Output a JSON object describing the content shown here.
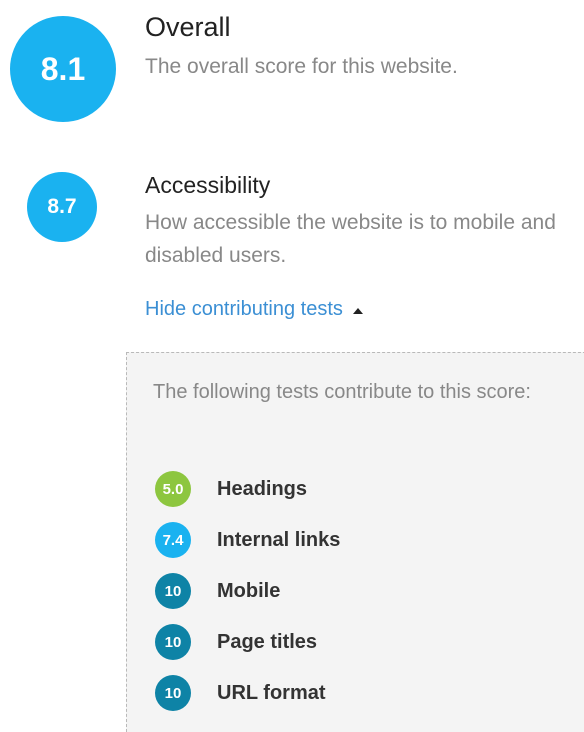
{
  "overall": {
    "score": "8.1",
    "title": "Overall",
    "description": "The overall score for this website."
  },
  "accessibility": {
    "score": "8.7",
    "title": "Accessibility",
    "description": "How accessible the website is to mobile and disabled users.",
    "toggle_label": "Hide contributing tests",
    "panel": {
      "intro": "The following tests contribute to this score:",
      "tests": [
        {
          "score": "5.0",
          "name": "Headings",
          "color": "#8dc63f"
        },
        {
          "score": "7.4",
          "name": "Internal links",
          "color": "#1ab2f0"
        },
        {
          "score": "10",
          "name": "Mobile",
          "color": "#0e83a6"
        },
        {
          "score": "10",
          "name": "Page titles",
          "color": "#0e83a6"
        },
        {
          "score": "10",
          "name": "URL format",
          "color": "#0e83a6"
        }
      ]
    }
  },
  "colors": {
    "score_blue": "#1ab2f0",
    "score_dark": "#0e83a6",
    "score_green": "#8dc63f",
    "link": "#3b8fd4"
  },
  "icons": {
    "toggle": "caret-up-icon"
  }
}
